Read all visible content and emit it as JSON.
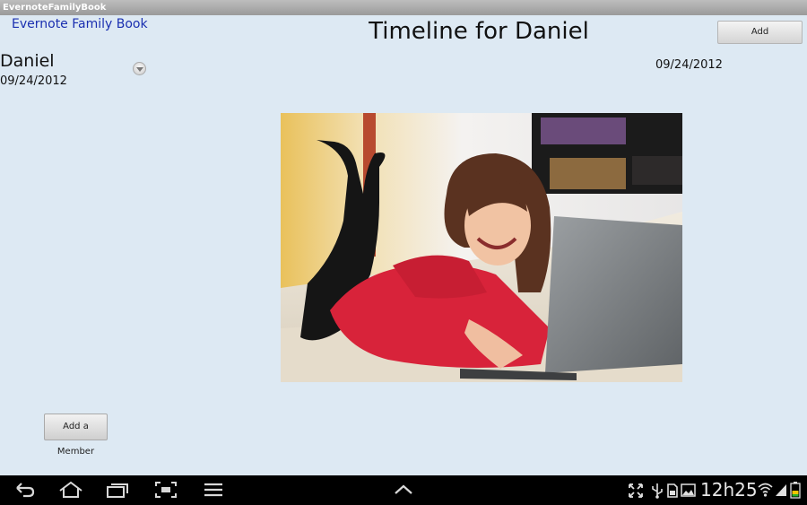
{
  "window": {
    "title": "EvernoteFamilyBook"
  },
  "header": {
    "link_label": "Evernote Family Book",
    "page_title": "Timeline for Daniel",
    "add_label": "Add"
  },
  "member": {
    "name": "Daniel",
    "date": "09/24/2012"
  },
  "entry": {
    "date": "09/24/2012",
    "photo_description": "photo"
  },
  "sidebar": {
    "add_member_label": "Add a Member"
  },
  "status_bar": {
    "time": "12h25"
  },
  "colors": {
    "background": "#dde9f3",
    "link": "#1a2fb0",
    "navbar": "#000000"
  }
}
